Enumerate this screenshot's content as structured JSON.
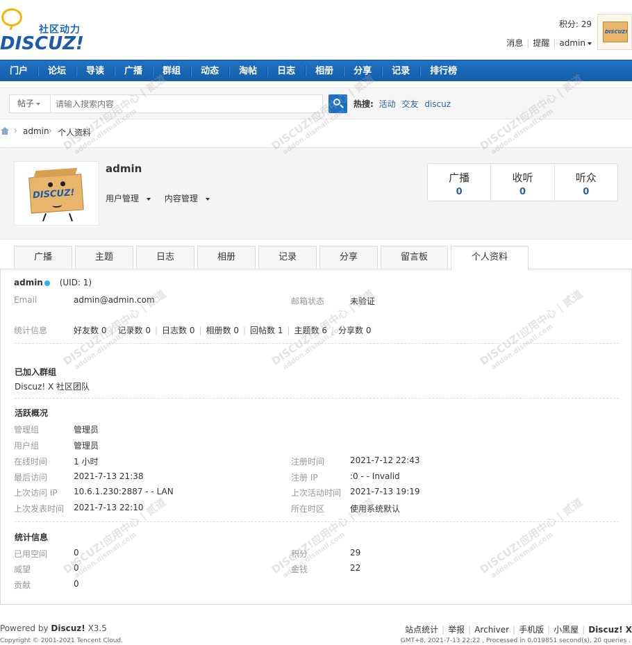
{
  "header": {
    "logo_cn": "社区动力",
    "logo_en": "DISCUZ!",
    "credits_label": "积分: 29",
    "links": [
      "消息",
      "提醒",
      "admin"
    ]
  },
  "nav": {
    "items": [
      "门户",
      "论坛",
      "导读",
      "广播",
      "群组",
      "动态",
      "淘帖",
      "日志",
      "相册",
      "分享",
      "记录",
      "排行榜"
    ]
  },
  "search": {
    "type_label": "帖子",
    "placeholder": "请输入搜索内容",
    "hot_label": "热搜:",
    "hot_links": [
      "活动",
      "交友",
      "discuz"
    ]
  },
  "breadcrumb": [
    "admin",
    "个人资料"
  ],
  "profile": {
    "name": "admin",
    "menus": [
      "用户管理",
      "内容管理"
    ],
    "stats": [
      {
        "label": "广播",
        "value": "0"
      },
      {
        "label": "收听",
        "value": "0"
      },
      {
        "label": "听众",
        "value": "0"
      }
    ]
  },
  "tabs": [
    "广播",
    "主题",
    "日志",
    "相册",
    "记录",
    "分享",
    "留言板",
    "个人资料"
  ],
  "info": {
    "username": "admin",
    "uid": "(UID: 1)",
    "email_label": "Email",
    "email": "admin@admin.com",
    "mail_status_label": "邮箱状态",
    "mail_status": "未验证",
    "stats_label": "统计信息",
    "counts": [
      "好友数 0",
      "记录数 0",
      "日志数 0",
      "相册数 0",
      "回帖数 1",
      "主题数 6",
      "分享数 0"
    ],
    "groups_title": "已加入群组",
    "groups": "Discuz! X 社区团队",
    "activity_title": "活跃概况",
    "admin_group_label": "管理组",
    "admin_group": "管理员",
    "user_group_label": "用户组",
    "user_group": "管理员",
    "online_label": "在线时间",
    "online": "1 小时",
    "reg_time_label": "注册时间",
    "reg_time": "2021-7-12 22:43",
    "last_visit_label": "最后访问",
    "last_visit": "2021-7-13 21:38",
    "reg_ip_label": "注册 IP",
    "reg_ip": ":0 - - Invalid",
    "last_ip_label": "上次访问 IP",
    "last_ip": "10.6.1.230:2887 - - LAN",
    "last_active_label": "上次活动时间",
    "last_active": "2021-7-13 19:19",
    "last_post_label": "上次发表时间",
    "last_post": "2021-7-13 22:10",
    "timezone_label": "所在时区",
    "timezone": "使用系统默认",
    "stat_title": "统计信息",
    "space_label": "已用空间",
    "space": "0",
    "points_label": "积分",
    "points": "29",
    "prestige_label": "威望",
    "prestige": "0",
    "money_label": "金钱",
    "money": "22",
    "contrib_label": "贡献",
    "contrib": "0"
  },
  "footer": {
    "powered_prefix": "Powered by",
    "powered_brand": "Discuz!",
    "powered_version": "X3.5",
    "copyright": "Copyright © 2001-2021 Tencent Cloud.",
    "links": [
      "站点统计",
      "举报",
      "Archiver",
      "手机版",
      "小黑屋",
      "Discuz! X"
    ],
    "processed": "GMT+8, 2021-7-13 22:22 , Processed in 0.019851 second(s), 20 queries ."
  },
  "watermark": {
    "main": "DISCUZ!应用中心 | 贰道",
    "sub": "addon.dismall.com"
  },
  "colors": {
    "nav_bg": "#1a69b8",
    "link": "#2a62a8",
    "accent_dot": "#2ab0e6"
  }
}
